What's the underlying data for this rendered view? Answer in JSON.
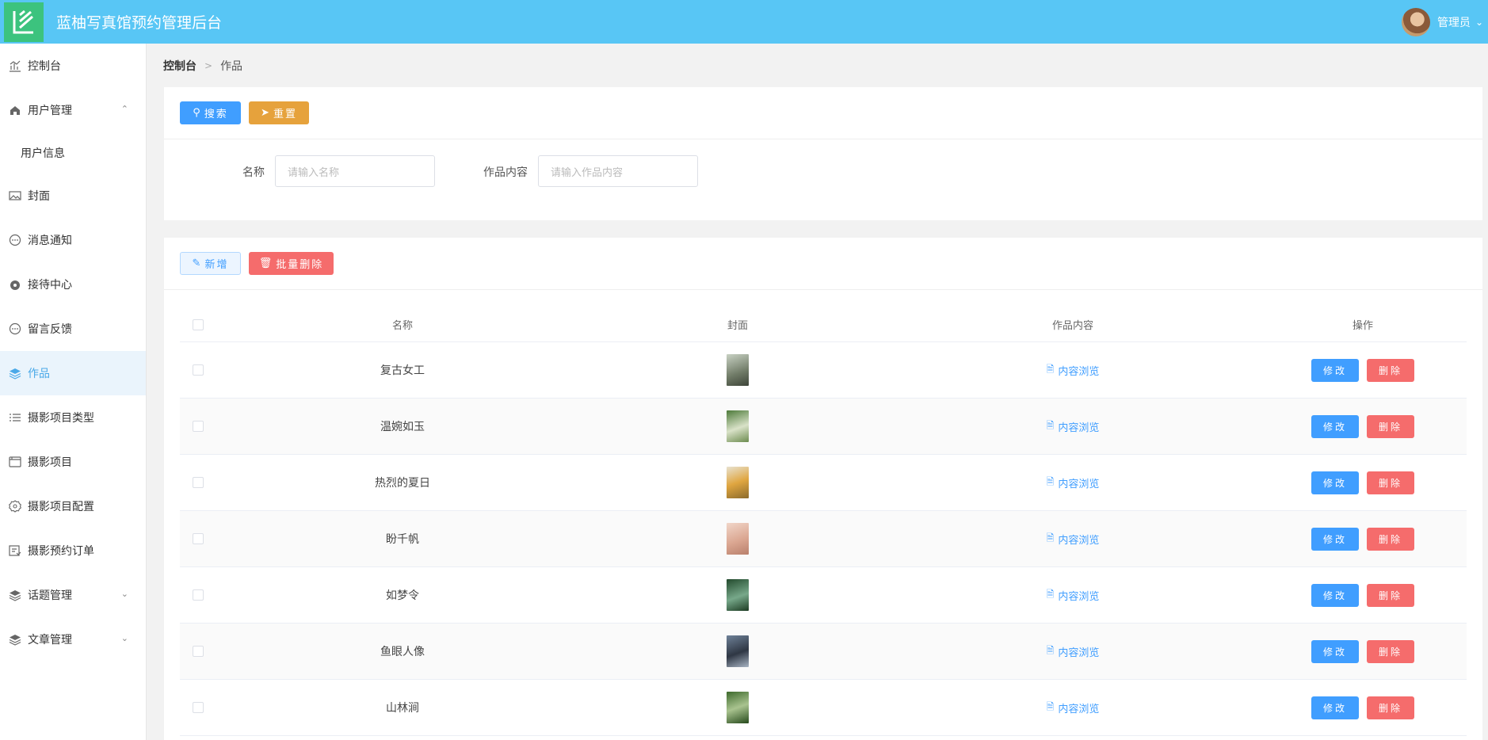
{
  "header": {
    "title": "蓝柚写真馆预约管理后台",
    "user_name": "管理员",
    "colors": {
      "header_bg": "#58c6f5",
      "logo_bg": "#3cc37e"
    }
  },
  "sidebar": {
    "items": [
      {
        "label": "控制台",
        "icon": "chart-icon"
      },
      {
        "label": "用户管理",
        "icon": "home-icon",
        "expanded": true
      },
      {
        "label": "封面",
        "icon": "image-icon"
      },
      {
        "label": "消息通知",
        "icon": "chat-icon"
      },
      {
        "label": "接待中心",
        "icon": "headset-icon"
      },
      {
        "label": "留言反馈",
        "icon": "chat-icon"
      },
      {
        "label": "作品",
        "icon": "layers-icon",
        "active": true
      },
      {
        "label": "摄影项目类型",
        "icon": "list-icon"
      },
      {
        "label": "摄影项目",
        "icon": "window-icon"
      },
      {
        "label": "摄影项目配置",
        "icon": "gear-icon"
      },
      {
        "label": "摄影预约订单",
        "icon": "order-icon"
      },
      {
        "label": "话题管理",
        "icon": "layers-icon",
        "expanded": false
      },
      {
        "label": "文章管理",
        "icon": "layers-icon",
        "expanded": false
      }
    ],
    "submenu": {
      "user_info": "用户信息"
    }
  },
  "breadcrumb": {
    "home": "控制台",
    "current": "作品"
  },
  "search": {
    "search_button": "搜索",
    "reset_button": "重置",
    "name_label": "名称",
    "name_placeholder": "请输入名称",
    "content_label": "作品内容",
    "content_placeholder": "请输入作品内容"
  },
  "toolbar": {
    "add_button": "新增",
    "batch_delete_button": "批量删除"
  },
  "table": {
    "headers": {
      "name": "名称",
      "cover": "封面",
      "content": "作品内容",
      "ops": "操作"
    },
    "link_label": "内容浏览",
    "edit_label": "修改",
    "delete_label": "删除",
    "rows": [
      {
        "name": "复古女工"
      },
      {
        "name": "温婉如玉"
      },
      {
        "name": "热烈的夏日"
      },
      {
        "name": "盼千帆"
      },
      {
        "name": "如梦令"
      },
      {
        "name": "鱼眼人像"
      },
      {
        "name": "山林涧"
      }
    ]
  }
}
